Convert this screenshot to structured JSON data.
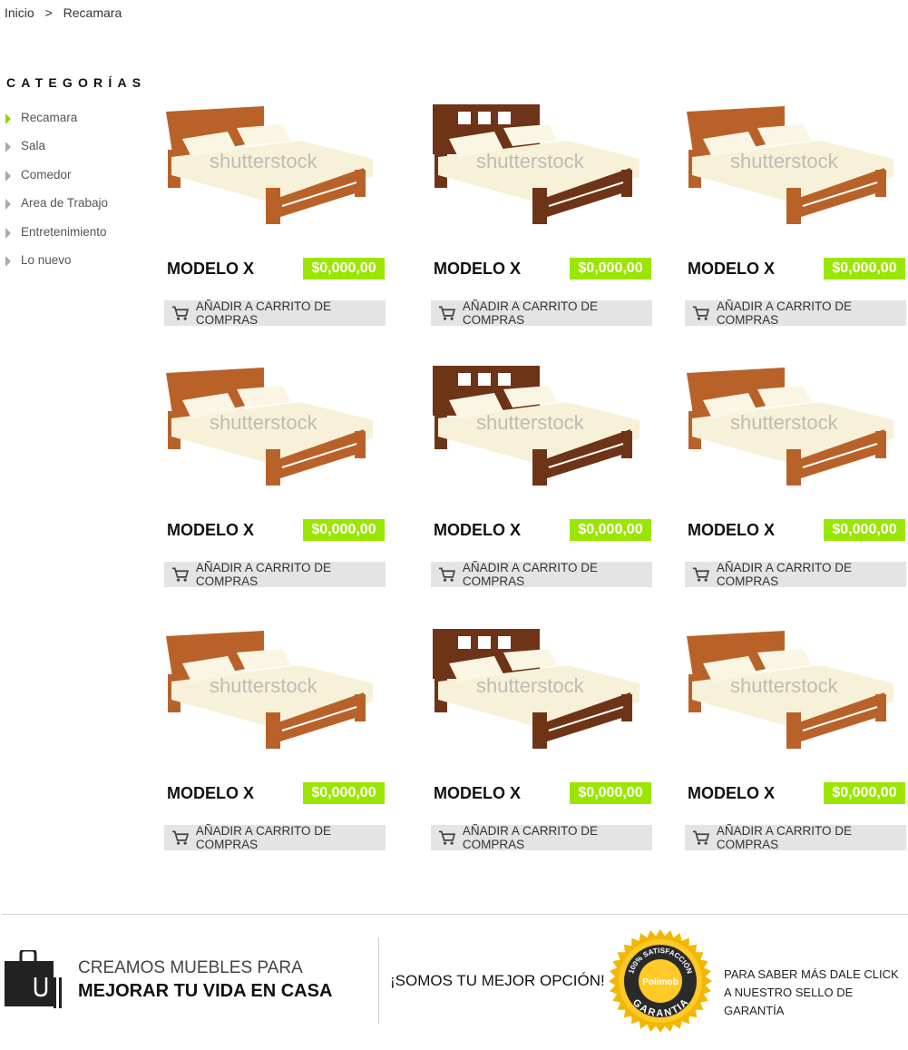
{
  "breadcrumb": {
    "items": [
      "Inicio",
      ">",
      "Recamara"
    ]
  },
  "sidebar": {
    "title": "CATEGORÍAS",
    "items": [
      {
        "label": "Recamara",
        "active": true
      },
      {
        "label": "Sala"
      },
      {
        "label": "Comedor"
      },
      {
        "label": "Area de Trabajo"
      },
      {
        "label": "Entretenimiento"
      },
      {
        "label": "Lo nuevo"
      }
    ]
  },
  "products": [
    {
      "title": "MODELO X",
      "price": "$0,000,00",
      "button": "AÑADIR A CARRITO DE COMPRAS",
      "variant": "light"
    },
    {
      "title": "MODELO X",
      "price": "$0,000,00",
      "button": "AÑADIR A CARRITO DE COMPRAS",
      "variant": "dark"
    },
    {
      "title": "MODELO X",
      "price": "$0,000,00",
      "button": "AÑADIR A CARRITO DE COMPRAS",
      "variant": "light"
    },
    {
      "title": "MODELO X",
      "price": "$0,000,00",
      "button": "AÑADIR A CARRITO DE COMPRAS",
      "variant": "light"
    },
    {
      "title": "MODELO X",
      "price": "$0,000,00",
      "button": "AÑADIR A CARRITO DE COMPRAS",
      "variant": "dark"
    },
    {
      "title": "MODELO X",
      "price": "$0,000,00",
      "button": "AÑADIR A CARRITO DE COMPRAS",
      "variant": "light"
    },
    {
      "title": "MODELO X",
      "price": "$0,000,00",
      "button": "AÑADIR A CARRITO DE COMPRAS",
      "variant": "light"
    },
    {
      "title": "MODELO X",
      "price": "$0,000,00",
      "button": "AÑADIR A CARRITO DE COMPRAS",
      "variant": "dark"
    },
    {
      "title": "MODELO X",
      "price": "$0,000,00",
      "button": "AÑADIR A CARRITO DE COMPRAS",
      "variant": "light"
    }
  ],
  "image_watermark": "shutterstock",
  "footer": {
    "line1": "CREAMOS MUEBLES PARA",
    "line2": "MEJORAR TU VIDA EN CASA",
    "slogan": "¡SOMOS TU MEJOR OPCIÓN!",
    "seal": {
      "top": "100% SATISFACCIÓN",
      "center": "Polimob",
      "bottom": "GARANTIA"
    },
    "info1": "PARA SABER MÁS DALE CLICK",
    "info2": "A NUESTRO SELLO DE GARANTÍA"
  },
  "colors": {
    "accent": "#9be600"
  }
}
